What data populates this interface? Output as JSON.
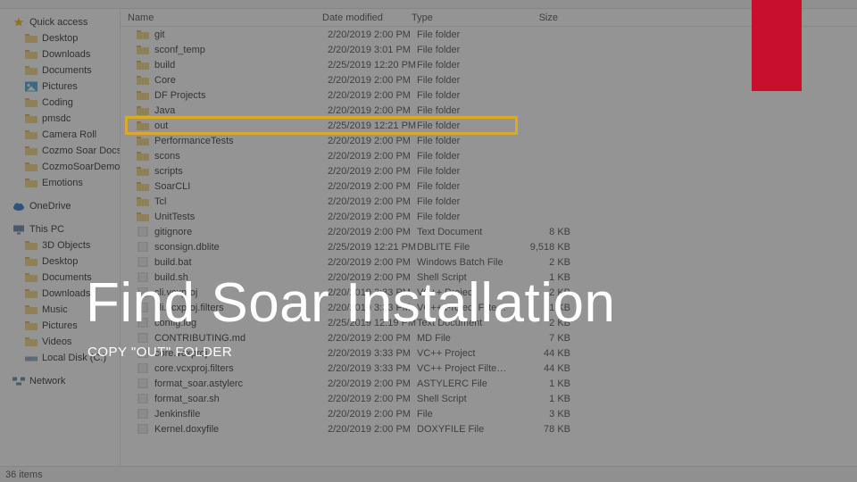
{
  "overlay": {
    "title": "Find Soar Installation",
    "subtitle": "COPY \"OUT\" FOLDER"
  },
  "columns": {
    "name": "Name",
    "date": "Date modified",
    "type": "Type",
    "size": "Size"
  },
  "status": "36 items",
  "highlight_row": 6,
  "nav": [
    {
      "label": "Quick access",
      "icon": "star",
      "indent": false
    },
    {
      "label": "Desktop",
      "icon": "folder",
      "indent": true
    },
    {
      "label": "Downloads",
      "icon": "folder",
      "indent": true
    },
    {
      "label": "Documents",
      "icon": "folder",
      "indent": true
    },
    {
      "label": "Pictures",
      "icon": "pictures",
      "indent": true
    },
    {
      "label": "Coding",
      "icon": "folder",
      "indent": true
    },
    {
      "label": "pmsdc",
      "icon": "folder",
      "indent": true
    },
    {
      "label": "Camera Roll",
      "icon": "folder",
      "indent": true
    },
    {
      "label": "Cozmo Soar Docs",
      "icon": "folder",
      "indent": true
    },
    {
      "label": "CozmoSoarDemo",
      "icon": "folder",
      "indent": true
    },
    {
      "label": "Emotions",
      "icon": "folder",
      "indent": true
    },
    {
      "label": "",
      "icon": "sep",
      "indent": false
    },
    {
      "label": "OneDrive",
      "icon": "cloud",
      "indent": false
    },
    {
      "label": "",
      "icon": "sep",
      "indent": false
    },
    {
      "label": "This PC",
      "icon": "pc",
      "indent": false
    },
    {
      "label": "3D Objects",
      "icon": "folder",
      "indent": true
    },
    {
      "label": "Desktop",
      "icon": "folder",
      "indent": true
    },
    {
      "label": "Documents",
      "icon": "folder",
      "indent": true
    },
    {
      "label": "Downloads",
      "icon": "folder",
      "indent": true
    },
    {
      "label": "Music",
      "icon": "folder",
      "indent": true
    },
    {
      "label": "Pictures",
      "icon": "folder",
      "indent": true
    },
    {
      "label": "Videos",
      "icon": "folder",
      "indent": true
    },
    {
      "label": "Local Disk (C:)",
      "icon": "drive",
      "indent": true
    },
    {
      "label": "",
      "icon": "sep",
      "indent": false
    },
    {
      "label": "Network",
      "icon": "network",
      "indent": false
    }
  ],
  "files": [
    {
      "name": "git",
      "date": "2/20/2019 2:00 PM",
      "type": "File folder",
      "size": "",
      "icon": "folder"
    },
    {
      "name": "sconf_temp",
      "date": "2/20/2019 3:01 PM",
      "type": "File folder",
      "size": "",
      "icon": "folder"
    },
    {
      "name": "build",
      "date": "2/25/2019 12:20 PM",
      "type": "File folder",
      "size": "",
      "icon": "folder"
    },
    {
      "name": "Core",
      "date": "2/20/2019 2:00 PM",
      "type": "File folder",
      "size": "",
      "icon": "folder"
    },
    {
      "name": "DF Projects",
      "date": "2/20/2019 2:00 PM",
      "type": "File folder",
      "size": "",
      "icon": "folder"
    },
    {
      "name": "Java",
      "date": "2/20/2019 2:00 PM",
      "type": "File folder",
      "size": "",
      "icon": "folder"
    },
    {
      "name": "out",
      "date": "2/25/2019 12:21 PM",
      "type": "File folder",
      "size": "",
      "icon": "folder"
    },
    {
      "name": "PerformanceTests",
      "date": "2/20/2019 2:00 PM",
      "type": "File folder",
      "size": "",
      "icon": "folder"
    },
    {
      "name": "scons",
      "date": "2/20/2019 2:00 PM",
      "type": "File folder",
      "size": "",
      "icon": "folder"
    },
    {
      "name": "scripts",
      "date": "2/20/2019 2:00 PM",
      "type": "File folder",
      "size": "",
      "icon": "folder"
    },
    {
      "name": "SoarCLI",
      "date": "2/20/2019 2:00 PM",
      "type": "File folder",
      "size": "",
      "icon": "folder"
    },
    {
      "name": "Tcl",
      "date": "2/20/2019 2:00 PM",
      "type": "File folder",
      "size": "",
      "icon": "folder"
    },
    {
      "name": "UnitTests",
      "date": "2/20/2019 2:00 PM",
      "type": "File folder",
      "size": "",
      "icon": "folder"
    },
    {
      "name": "gitignore",
      "date": "2/20/2019 2:00 PM",
      "type": "Text Document",
      "size": "8 KB",
      "icon": "doc"
    },
    {
      "name": "sconsign.dblite",
      "date": "2/25/2019 12:21 PM",
      "type": "DBLITE File",
      "size": "9,518 KB",
      "icon": "doc"
    },
    {
      "name": "build.bat",
      "date": "2/20/2019 2:00 PM",
      "type": "Windows Batch File",
      "size": "2 KB",
      "icon": "doc"
    },
    {
      "name": "build.sh",
      "date": "2/20/2019 2:00 PM",
      "type": "Shell Script",
      "size": "1 KB",
      "icon": "doc"
    },
    {
      "name": "cli.vcxproj",
      "date": "2/20/2019 3:33 PM",
      "type": "VC++ Project",
      "size": "2 KB",
      "icon": "doc"
    },
    {
      "name": "cli.vcxproj.filters",
      "date": "2/20/2019 3:33 PM",
      "type": "VC++ Project Filte…",
      "size": "1 KB",
      "icon": "doc"
    },
    {
      "name": "config.log",
      "date": "2/25/2019 12:19 PM",
      "type": "Text Document",
      "size": "2 KB",
      "icon": "doc"
    },
    {
      "name": "CONTRIBUTING.md",
      "date": "2/20/2019 2:00 PM",
      "type": "MD File",
      "size": "7 KB",
      "icon": "doc"
    },
    {
      "name": "core.vcxproj",
      "date": "2/20/2019 3:33 PM",
      "type": "VC++ Project",
      "size": "44 KB",
      "icon": "doc"
    },
    {
      "name": "core.vcxproj.filters",
      "date": "2/20/2019 3:33 PM",
      "type": "VC++ Project Filte…",
      "size": "44 KB",
      "icon": "doc"
    },
    {
      "name": "format_soar.astylerc",
      "date": "2/20/2019 2:00 PM",
      "type": "ASTYLERC File",
      "size": "1 KB",
      "icon": "doc"
    },
    {
      "name": "format_soar.sh",
      "date": "2/20/2019 2:00 PM",
      "type": "Shell Script",
      "size": "1 KB",
      "icon": "doc"
    },
    {
      "name": "Jenkinsfile",
      "date": "2/20/2019 2:00 PM",
      "type": "File",
      "size": "3 KB",
      "icon": "doc"
    },
    {
      "name": "Kernel.doxyfile",
      "date": "2/20/2019 2:00 PM",
      "type": "DOXYFILE File",
      "size": "78 KB",
      "icon": "doc"
    }
  ]
}
